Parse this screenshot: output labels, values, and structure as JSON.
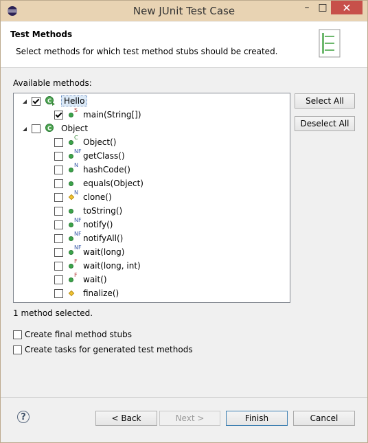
{
  "window": {
    "title": "New JUnit Test Case",
    "minimize_glyph": "–",
    "maximize_glyph": "□",
    "close_glyph": "✕"
  },
  "header": {
    "title": "Test Methods",
    "description": "Select methods for which test method stubs should be created."
  },
  "available_label": "Available methods:",
  "tree": [
    {
      "level": 0,
      "expanded": true,
      "checked": true,
      "icon": "class-icon",
      "label": "Hello",
      "selected": true
    },
    {
      "level": 1,
      "checked": true,
      "icon": "public-method-icon",
      "modifier": "S",
      "label": "main(String[])"
    },
    {
      "level": 0,
      "expanded": true,
      "checked": false,
      "icon": "class-icon",
      "label": "Object"
    },
    {
      "level": 1,
      "checked": false,
      "icon": "public-method-icon",
      "modifier": "C",
      "label": "Object()"
    },
    {
      "level": 1,
      "checked": false,
      "icon": "public-method-icon",
      "modifier": "NF",
      "label": "getClass()"
    },
    {
      "level": 1,
      "checked": false,
      "icon": "public-method-icon",
      "modifier": "N",
      "label": "hashCode()"
    },
    {
      "level": 1,
      "checked": false,
      "icon": "public-method-icon",
      "modifier": "",
      "label": "equals(Object)"
    },
    {
      "level": 1,
      "checked": false,
      "icon": "protected-method-icon",
      "modifier": "N",
      "label": "clone()"
    },
    {
      "level": 1,
      "checked": false,
      "icon": "public-method-icon",
      "modifier": "",
      "label": "toString()"
    },
    {
      "level": 1,
      "checked": false,
      "icon": "public-method-icon",
      "modifier": "NF",
      "label": "notify()"
    },
    {
      "level": 1,
      "checked": false,
      "icon": "public-method-icon",
      "modifier": "NF",
      "label": "notifyAll()"
    },
    {
      "level": 1,
      "checked": false,
      "icon": "public-method-icon",
      "modifier": "NF",
      "label": "wait(long)"
    },
    {
      "level": 1,
      "checked": false,
      "icon": "public-method-icon",
      "modifier": "F",
      "label": "wait(long, int)"
    },
    {
      "level": 1,
      "checked": false,
      "icon": "public-method-icon",
      "modifier": "F",
      "label": "wait()"
    },
    {
      "level": 1,
      "checked": false,
      "icon": "protected-method-icon",
      "modifier": "",
      "label": "finalize()"
    }
  ],
  "buttons": {
    "select_all": "Select All",
    "deselect_all": "Deselect All",
    "back": "< Back",
    "next": "Next >",
    "finish": "Finish",
    "cancel": "Cancel"
  },
  "status": "1 method selected.",
  "options": [
    {
      "label": "Create final method stubs",
      "checked": false
    },
    {
      "label": "Create tasks for generated test methods",
      "checked": false
    }
  ],
  "help_glyph": "?",
  "colors": {
    "titlebar": "#e8d3b3",
    "close_button": "#c7504a",
    "method_public": "#3ca44a",
    "method_protected": "#f1c232",
    "selection": "#dbe9f7"
  }
}
